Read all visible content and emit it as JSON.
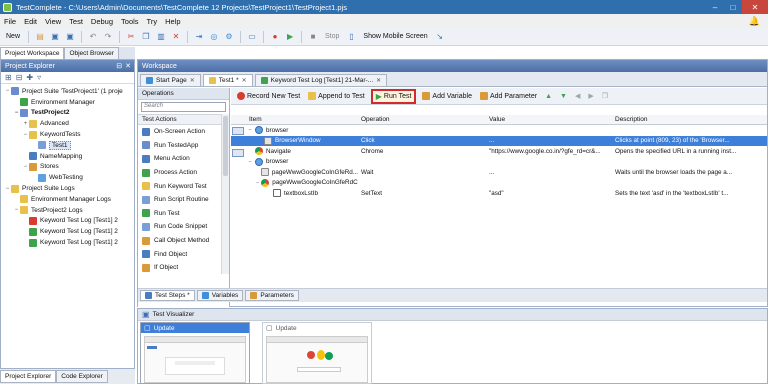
{
  "window": {
    "title": "TestComplete - C:\\Users\\Admin\\Documents\\TestComplete 12 Projects\\TestProject1\\TestProject1.pjs",
    "controls": [
      "–",
      "□",
      "✕"
    ]
  },
  "menu": [
    "File",
    "Edit",
    "View",
    "Test",
    "Debug",
    "Tools",
    "Try",
    "Help"
  ],
  "toolbar": {
    "new_label": "New",
    "stop_label": "Stop",
    "show_mobile_label": "Show Mobile Screen"
  },
  "workspace_tabs": [
    "Project Workspace",
    "Object Browser"
  ],
  "project_explorer": {
    "title": "Project Explorer",
    "tree": [
      {
        "label": "Project Suite 'TestProject1' (1 proje",
        "indent": 0,
        "exp": "−",
        "icon": "#6a8ccf"
      },
      {
        "label": "Environment Manager",
        "indent": 1,
        "exp": "",
        "icon": "#3ea34a"
      },
      {
        "label": "TestProject2",
        "indent": 1,
        "exp": "−",
        "icon": "#6a8ccf",
        "bold": true
      },
      {
        "label": "Advanced",
        "indent": 2,
        "exp": "+",
        "icon": "#e8c14a"
      },
      {
        "label": "KeywordTests",
        "indent": 2,
        "exp": "−",
        "icon": "#e8c14a"
      },
      {
        "label": "Test1",
        "indent": 3,
        "exp": "",
        "icon": "#7a9ed6",
        "sel": true
      },
      {
        "label": "NameMapping",
        "indent": 2,
        "exp": "",
        "icon": "#4a7cc0"
      },
      {
        "label": "Stores",
        "indent": 2,
        "exp": "−",
        "icon": "#d99a3a"
      },
      {
        "label": "WebTesting",
        "indent": 3,
        "exp": "",
        "icon": "#5ea0e0"
      },
      {
        "label": "Project Suite Logs",
        "indent": 0,
        "exp": "−",
        "icon": "#e8c14a"
      },
      {
        "label": "Environment Manager Logs",
        "indent": 1,
        "exp": "",
        "icon": "#e8c14a"
      },
      {
        "label": "TestProject2 Logs",
        "indent": 1,
        "exp": "−",
        "icon": "#e8c14a"
      },
      {
        "label": "Keyword Test Log [Test1] 2",
        "indent": 2,
        "exp": "",
        "icon": "#d83b2f"
      },
      {
        "label": "Keyword Test Log [Test1] 2",
        "indent": 2,
        "exp": "",
        "icon": "#3ea34a"
      },
      {
        "label": "Keyword Test Log [Test1] 2",
        "indent": 2,
        "exp": "",
        "icon": "#3ea34a"
      }
    ],
    "bottom_tabs": [
      "Project Explorer",
      "Code Explorer"
    ]
  },
  "workspace": {
    "title": "Workspace",
    "doc_tabs": [
      {
        "label": "Start Page",
        "icon": "#3e8fd8"
      },
      {
        "label": "Test1 *",
        "icon": "#e8c14a",
        "active": true
      },
      {
        "label": "Keyword Test Log [Test1] 21-Mar-...",
        "icon": "#3ea34a"
      }
    ],
    "operations": {
      "title": "Operations",
      "search_placeholder": "Search",
      "category": "Test Actions",
      "items": [
        {
          "label": "On-Screen Action",
          "icon": "#4a7cc0"
        },
        {
          "label": "Run TestedApp",
          "icon": "#6a8ccf"
        },
        {
          "label": "Menu Action",
          "icon": "#4a7cc0"
        },
        {
          "label": "Process Action",
          "icon": "#3ea34a"
        },
        {
          "label": "Run Keyword Test",
          "icon": "#e8c14a"
        },
        {
          "label": "Run Script Routine",
          "icon": "#7a9ed6"
        },
        {
          "label": "Run Test",
          "icon": "#3ea34a"
        },
        {
          "label": "Run Code Snippet",
          "icon": "#7a9ed6"
        },
        {
          "label": "Call Object Method",
          "icon": "#d99a3a"
        },
        {
          "label": "Find Object",
          "icon": "#4a7cc0"
        },
        {
          "label": "If Object",
          "icon": "#d99a3a"
        }
      ]
    },
    "editor_toolbar": {
      "record": "Record New Test",
      "append": "Append to Test",
      "run": "Run Test",
      "add_variable": "Add Variable",
      "add_parameter": "Add Parameter"
    },
    "grid": {
      "columns": [
        "Item",
        "Operation",
        "Value",
        "Description"
      ],
      "rows": [
        {
          "indent": 0,
          "exp": "−",
          "icon": "globe",
          "item": "browser",
          "op": "",
          "val": "",
          "desc": ""
        },
        {
          "indent": 1,
          "exp": "",
          "icon": "win",
          "item": "BrowserWindow",
          "op": "Click",
          "val": "...",
          "desc": "Clicks at point (809, 23) of the 'Browser...",
          "sel": true
        },
        {
          "indent": 0,
          "exp": "",
          "icon": "chrome",
          "item": "Navigate",
          "op": "Chrome",
          "val": "\"https://www.google.co.in/?gfe_rd=cr&...",
          "desc": "Opens the specified URL in a running inst..."
        },
        {
          "indent": 0,
          "exp": "−",
          "icon": "globe",
          "item": "browser",
          "op": "",
          "val": "",
          "desc": ""
        },
        {
          "indent": 1,
          "exp": "",
          "icon": "win",
          "item": "pageWwwGoogleCoInGfeRd...",
          "op": "Wait",
          "val": "...",
          "desc": "Waits until the browser loads the page a..."
        },
        {
          "indent": 1,
          "exp": "−",
          "icon": "chrome",
          "item": "pageWwwGoogleCoInGfeRdCrEiPmtqwi",
          "op": "",
          "val": "",
          "desc": ""
        },
        {
          "indent": 2,
          "exp": "",
          "icon": "txt",
          "item": "textboxLstIb",
          "op": "SetText",
          "val": "\"asd\"",
          "desc": "Sets the text 'asd' in the 'textboxLstIb' t..."
        }
      ]
    },
    "bottom_tabs": [
      {
        "label": "Test Steps *",
        "icon": "#4a7cc0",
        "active": true
      },
      {
        "label": "Variables",
        "icon": "#3e8fd8"
      },
      {
        "label": "Parameters",
        "icon": "#d99a3a"
      }
    ]
  },
  "visualizer": {
    "title": "Test Visualizer",
    "frames": [
      {
        "label": "Update",
        "active": true
      },
      {
        "label": "Update",
        "active": false
      }
    ]
  }
}
